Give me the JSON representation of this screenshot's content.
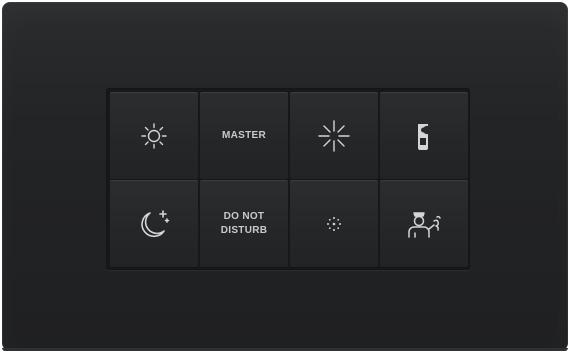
{
  "panel": {
    "buttons": [
      {
        "icon": "sun-icon"
      },
      {
        "label": "MASTER"
      },
      {
        "icon": "bright-sun-icon"
      },
      {
        "icon": "door-hanger-icon"
      },
      {
        "icon": "moon-stars-icon"
      },
      {
        "label_line1": "DO NOT",
        "label_line2": "DISTURB"
      },
      {
        "icon": "dim-sparkle-icon"
      },
      {
        "icon": "housekeeping-icon"
      }
    ],
    "colors": {
      "plate": "#232426",
      "button": "#262729",
      "icon": "#d4d5d7"
    }
  }
}
